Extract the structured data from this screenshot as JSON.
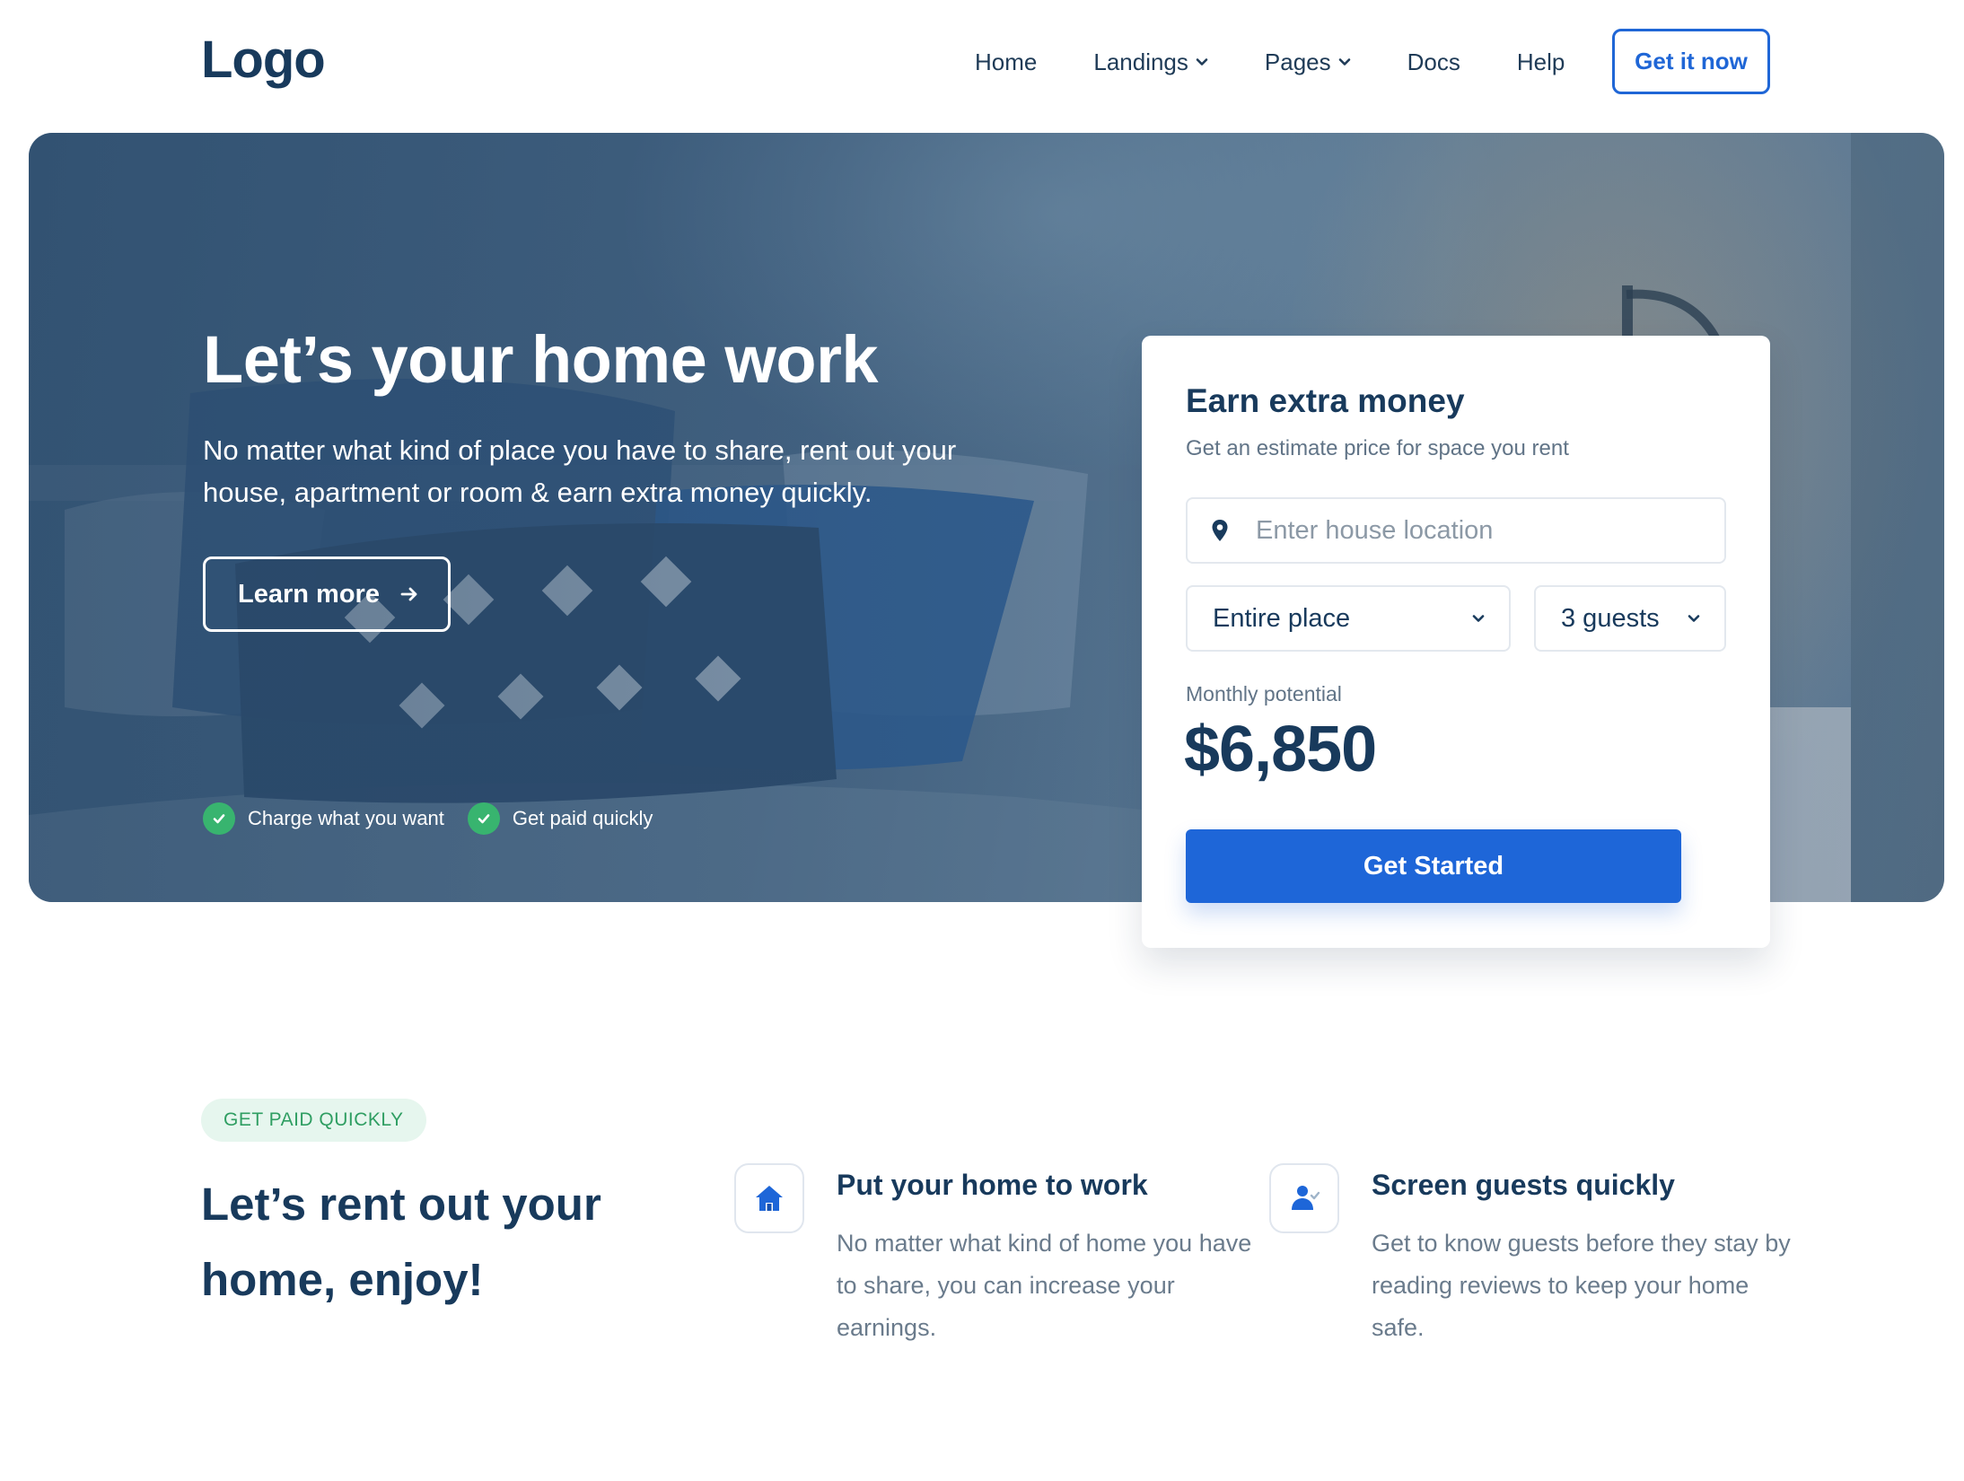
{
  "nav": {
    "logo": "Logo",
    "items": [
      {
        "label": "Home",
        "dropdown": false
      },
      {
        "label": "Landings",
        "dropdown": true
      },
      {
        "label": "Pages",
        "dropdown": true
      },
      {
        "label": "Docs",
        "dropdown": false
      },
      {
        "label": "Help",
        "dropdown": false
      }
    ],
    "cta": "Get it now"
  },
  "hero": {
    "title": "Let’s your home work",
    "subtitle": "No matter what kind of place you have to share, rent out your house, apartment or room & earn extra money quickly.",
    "button": "Learn more",
    "checks": [
      "Charge what you want",
      "Get paid quickly"
    ]
  },
  "card": {
    "title": "Earn extra money",
    "subtitle": "Get an estimate price for space you rent",
    "location_placeholder": "Enter house location",
    "place_type": "Entire place",
    "guests": "3 guests",
    "potential_label": "Monthly potential",
    "potential_amount": "$6,850",
    "button": "Get Started"
  },
  "features": {
    "badge": "GET PAID QUICKLY",
    "title": "Let’s rent out your home, enjoy!",
    "items": [
      {
        "icon": "home-icon",
        "heading": "Put your home to work",
        "text": "No matter what kind of home you have to share, you can increase your earnings."
      },
      {
        "icon": "user-check-icon",
        "heading": "Screen guests quickly",
        "text": "Get to know guests before they stay by reading reviews to keep your home safe."
      }
    ]
  },
  "colors": {
    "primary": "#1e66d8",
    "heading": "#183a5c",
    "success": "#38b46f",
    "badge_bg": "#e6f6ee"
  }
}
